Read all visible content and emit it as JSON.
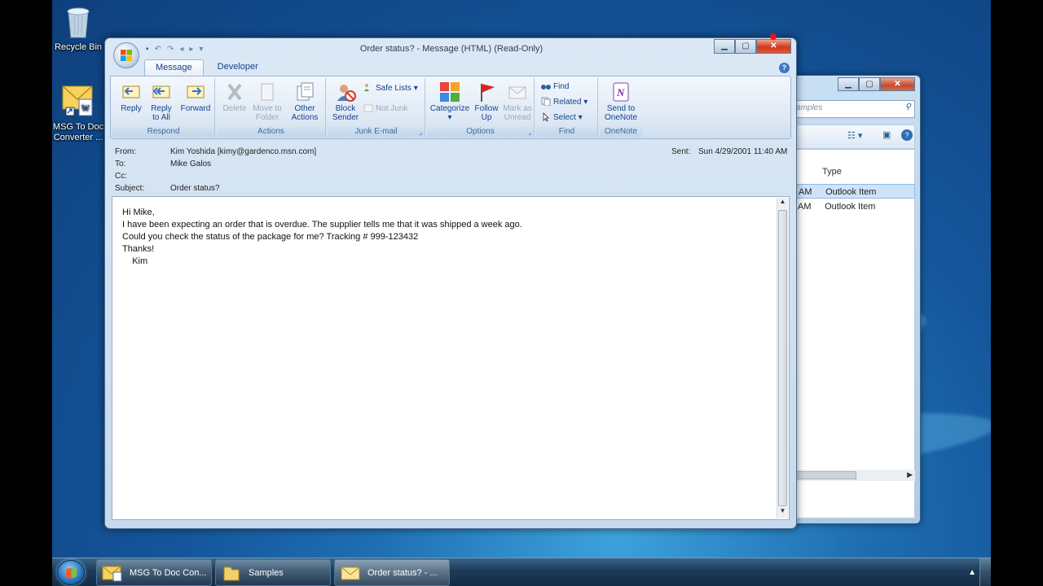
{
  "desktop": {
    "icons": [
      {
        "label": "Recycle Bin"
      },
      {
        "label": "MSG To Doc Converter ..."
      }
    ]
  },
  "taskbar": {
    "buttons": [
      {
        "label": "MSG To Doc Con..."
      },
      {
        "label": "Samples"
      },
      {
        "label": "Order status? - ..."
      }
    ]
  },
  "explorer": {
    "search_placeholder": "Search Samples",
    "column_type": "Type",
    "rows": [
      {
        "time": "AM",
        "type": "Outlook Item"
      },
      {
        "time": "AM",
        "type": "Outlook Item"
      }
    ]
  },
  "message": {
    "window_title": "Order status? - Message (HTML) (Read-Only)",
    "tabs": [
      "Message",
      "Developer"
    ],
    "ribbon": {
      "respond": {
        "label": "Respond",
        "reply": "Reply",
        "reply_all": "Reply to All",
        "forward": "Forward"
      },
      "actions": {
        "label": "Actions",
        "delete": "Delete",
        "move_to_folder": "Move to Folder",
        "other_actions": "Other Actions"
      },
      "junk": {
        "label": "Junk E-mail",
        "block_sender": "Block Sender",
        "safe_lists": "Safe Lists",
        "not_junk": "Not Junk"
      },
      "options": {
        "label": "Options",
        "categorize": "Categorize",
        "follow_up": "Follow Up",
        "mark_as_unread": "Mark as Unread"
      },
      "find": {
        "label": "Find",
        "find": "Find",
        "related": "Related",
        "select": "Select"
      },
      "onenote": {
        "label": "OneNote",
        "send_to_onenote": "Send to OneNote"
      }
    },
    "headers": {
      "from_label": "From:",
      "from_value": "Kim Yoshida [kimy@gardenco.msn.com]",
      "to_label": "To:",
      "to_value": "Mike Galos",
      "cc_label": "Cc:",
      "cc_value": "",
      "subject_label": "Subject:",
      "subject_value": "Order status?",
      "sent_label": "Sent:",
      "sent_value": "Sun 4/29/2001 11:40 AM"
    },
    "body": [
      "Hi Mike,",
      "I have been expecting an order that is overdue. The supplier tells me that it was shipped a week ago.",
      "",
      "Could you check the status of the package for me? Tracking # 999-123432",
      "",
      "Thanks!",
      "    Kim"
    ]
  }
}
